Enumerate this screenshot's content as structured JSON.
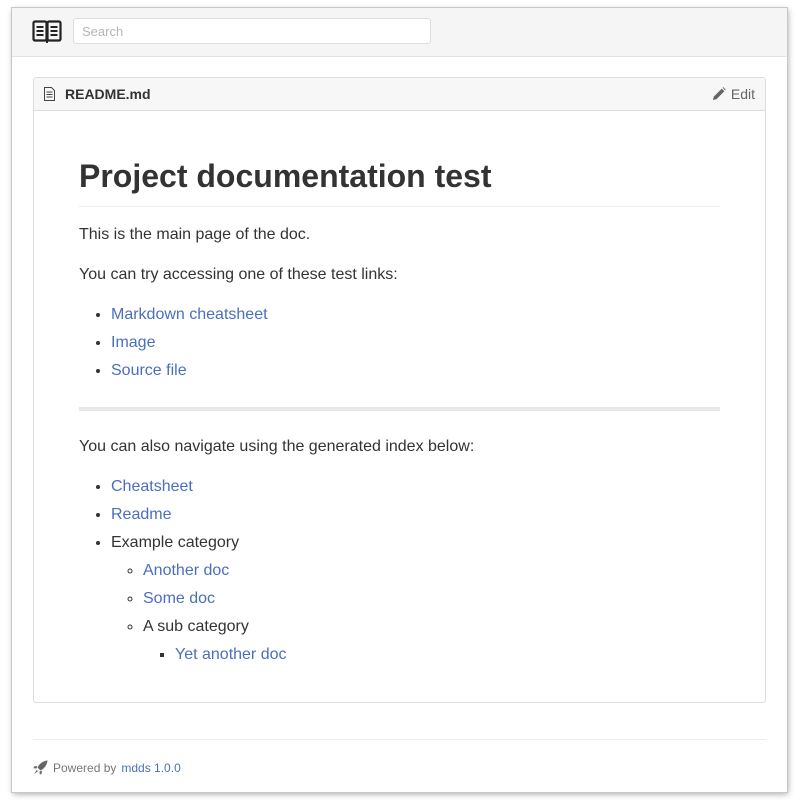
{
  "header": {
    "logo_icon": "open-book-icon",
    "search_placeholder": "Search",
    "search_value": ""
  },
  "file": {
    "icon": "file-text-icon",
    "name": "README.md",
    "edit_icon": "pencil-icon",
    "edit_label": "Edit"
  },
  "doc": {
    "title": "Project documentation test",
    "intro": "This is the main page of the doc.",
    "links_intro": "You can try accessing one of these test links:",
    "test_links": [
      {
        "label": "Markdown cheatsheet"
      },
      {
        "label": "Image"
      },
      {
        "label": "Source file"
      }
    ],
    "index_intro": "You can also navigate using the generated index below:",
    "index": {
      "cheatsheet": "Cheatsheet",
      "readme": "Readme",
      "example_category": "Example category",
      "another_doc": "Another doc",
      "some_doc": "Some doc",
      "sub_category": "A sub category",
      "yet_another_doc": "Yet another doc"
    }
  },
  "footer": {
    "icon": "rocket-icon",
    "powered_by": "Powered by",
    "link_label": "mdds 1.0.0"
  },
  "colors": {
    "link": "#4b6fbd",
    "text": "#333333",
    "header_bg": "#f5f5f5"
  }
}
